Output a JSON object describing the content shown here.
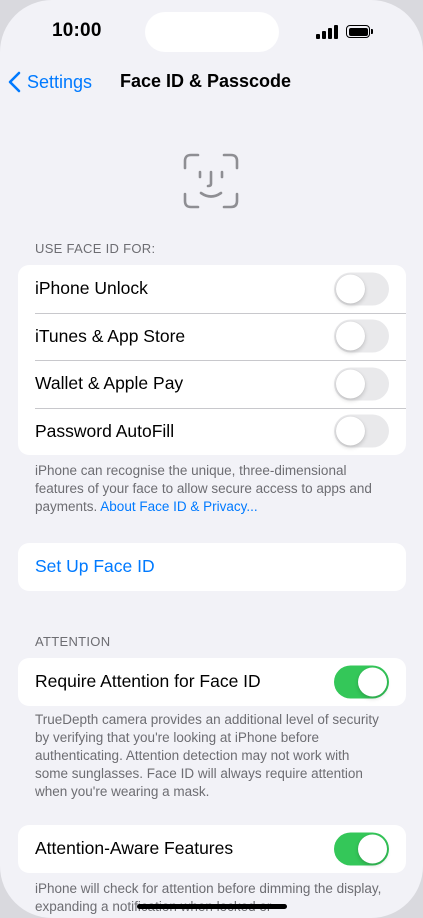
{
  "status_bar": {
    "time": "10:00"
  },
  "nav": {
    "back_label": "Settings",
    "title": "Face ID & Passcode"
  },
  "use_face_id": {
    "header": "USE FACE ID FOR:",
    "items": [
      {
        "label": "iPhone Unlock",
        "on": false
      },
      {
        "label": "iTunes & App Store",
        "on": false
      },
      {
        "label": "Wallet & Apple Pay",
        "on": false
      },
      {
        "label": "Password AutoFill",
        "on": false
      }
    ],
    "footer_text": "iPhone can recognise the unique, three-dimensional features of your face to allow secure access to apps and payments. ",
    "footer_link": "About Face ID & Privacy..."
  },
  "setup": {
    "label": "Set Up Face ID"
  },
  "attention": {
    "header": "ATTENTION",
    "require_label": "Require Attention for Face ID",
    "require_on": true,
    "footer_text": "TrueDepth camera provides an additional level of security by verifying that you're looking at iPhone before authenticating. Attention detection may not work with some sunglasses. Face ID will always require attention when you're wearing a mask."
  },
  "attention_aware": {
    "label": "Attention-Aware Features",
    "on": true,
    "footer_text": "iPhone will check for attention before dimming the display, expanding a notification when locked or"
  },
  "colors": {
    "accent": "#007aff",
    "toggle_on": "#34c759",
    "toggle_off": "#e9e9eb",
    "background": "#f2f2f7"
  }
}
